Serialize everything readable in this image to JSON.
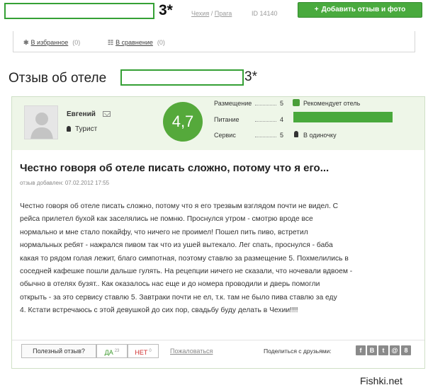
{
  "header": {
    "hotel_stars": "3*",
    "breadcrumb": {
      "country": "Чехия",
      "separator": " / ",
      "city": "Прага",
      "id_label": "ID 14140"
    },
    "add_button": {
      "icon": "plus-icon",
      "label": "Добавить отзыв и фото"
    }
  },
  "toolbar": {
    "favorites": {
      "icon": "star-icon",
      "label": "В избранное",
      "count": "(0)"
    },
    "compare": {
      "icon": "grid-icon",
      "label": "В сравнение",
      "count": "(0)"
    }
  },
  "review_heading": {
    "prefix": "Отзыв об отеле",
    "stars": "3*"
  },
  "review": {
    "author": {
      "name": "Евгений",
      "type": "Турист"
    },
    "score": "4,7",
    "ratings": [
      {
        "label": "Размещение",
        "value": "5"
      },
      {
        "label": "Питание",
        "value": "4"
      },
      {
        "label": "Сервис",
        "value": "5"
      }
    ],
    "recommends": "Рекомендует отель",
    "recommend_level": 1.0,
    "travel_type": "В одиночку",
    "title": "Честно говоря об отеле писать сложно, потому что я его...",
    "date": "отзыв добавлен: 07.02.2012 17:55",
    "body_lines": [
      "Честно говоря об отеле писать сложно, потому что я его трезвым взглядом почти не видел. С",
      "рейса прилетел бухой как заселялись не помню. Проснулся утром - смотрю вроде все",
      "нормально и мне стало покайфу, что ничего не проимел! Пошел пить пиво, встретил",
      "нормальных ребят - нажрался пивом так что из ушей вытекало. Лег спать, проснулся - баба",
      "какая то рядом голая лежит, благо симпотная, поэтому ставлю за размещение 5. Похмелились в",
      "соседней кафешке пошли дальше гулять. На рецепции ничего не сказали, что ночевали вдвоем -",
      "обычно в отелях бузят.. Как оказалось нас еще и до номера проводили и дверь помогли",
      "открыть - за это сервису ставлю 5. Завтраки почти не ел, т.к. там не было пива ставлю за еду",
      "4. Кстати встречаюсь с этой девушкой до сих пор, свадьбу буду делать в Чехии!!!!"
    ]
  },
  "feedback": {
    "useful_label": "Полезный отзыв?",
    "yes_label": "ДА",
    "yes_count": "23",
    "no_label": "НЕТ",
    "no_count": "0",
    "complain_label": "Пожаловаться",
    "share_label": "Поделиться с друзьями:",
    "social": [
      {
        "icon": "facebook-icon",
        "glyph": "f"
      },
      {
        "icon": "vkontakte-icon",
        "glyph": "B"
      },
      {
        "icon": "twitter-icon",
        "glyph": "t"
      },
      {
        "icon": "mail-icon",
        "glyph": "@"
      },
      {
        "icon": "odnoklassniki-icon",
        "glyph": "8"
      }
    ]
  },
  "watermark": "Fishki.net"
}
